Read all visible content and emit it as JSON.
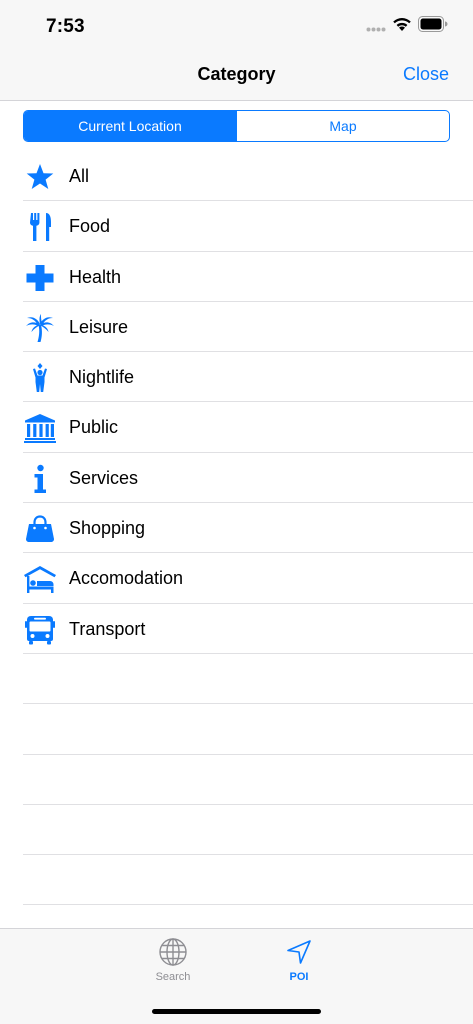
{
  "status_bar": {
    "time": "7:53"
  },
  "nav": {
    "title": "Category",
    "close_label": "Close"
  },
  "segments": [
    {
      "label": "Current Location",
      "selected": true
    },
    {
      "label": "Map",
      "selected": false
    }
  ],
  "categories": [
    {
      "label": "All",
      "icon": "star-icon"
    },
    {
      "label": "Food",
      "icon": "fork-knife-icon"
    },
    {
      "label": "Health",
      "icon": "cross-icon"
    },
    {
      "label": "Leisure",
      "icon": "palm-tree-icon"
    },
    {
      "label": "Nightlife",
      "icon": "dancer-icon"
    },
    {
      "label": "Public",
      "icon": "building-icon"
    },
    {
      "label": "Services",
      "icon": "info-icon"
    },
    {
      "label": "Shopping",
      "icon": "shopping-bag-icon"
    },
    {
      "label": "Accomodation",
      "icon": "bed-icon"
    },
    {
      "label": "Transport",
      "icon": "bus-icon"
    }
  ],
  "tabs": [
    {
      "label": "Search",
      "icon": "globe-icon",
      "selected": false
    },
    {
      "label": "POI",
      "icon": "location-arrow-icon",
      "selected": true
    }
  ],
  "colors": {
    "accent": "#0a7aff",
    "inactive": "#8e8e93",
    "bar_background": "#f7f7f7",
    "separator": "#e0e0e3"
  }
}
